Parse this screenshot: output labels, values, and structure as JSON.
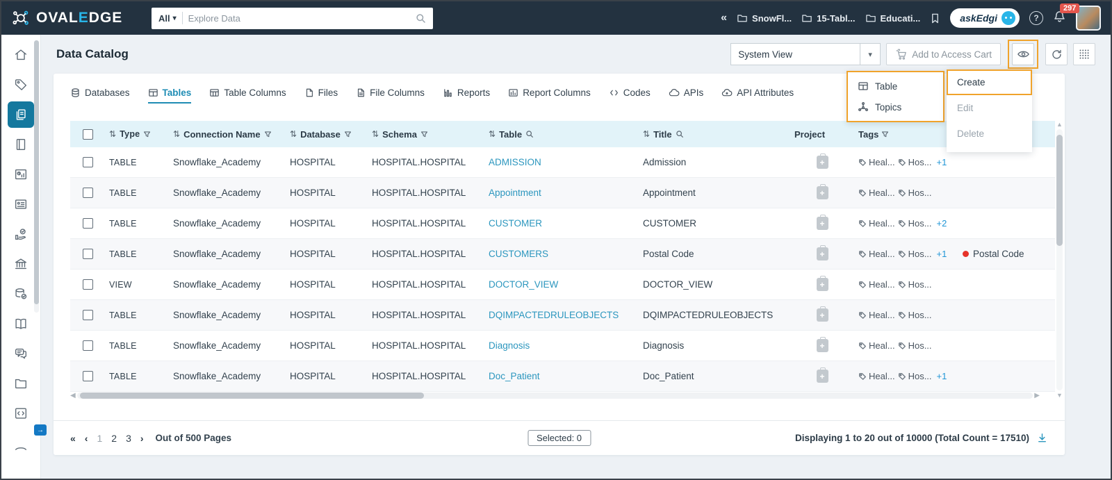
{
  "topbar": {
    "brand": "OVAL",
    "brand_accent": "E",
    "brand_rest": "DGE",
    "search_scope": "All",
    "search_placeholder": "Explore Data",
    "crumbs": [
      {
        "label": "SnowFl..."
      },
      {
        "label": "15-Tabl..."
      },
      {
        "label": "Educati..."
      }
    ],
    "ask_edgi_label": "askEdgi",
    "notification_count": "297"
  },
  "sidebar": {
    "items": [
      {
        "icon": "home-icon"
      },
      {
        "icon": "tag-icon"
      },
      {
        "icon": "data-catalog-icon",
        "active": true
      },
      {
        "icon": "notebook-icon"
      },
      {
        "icon": "report-clock-icon"
      },
      {
        "icon": "id-card-icon"
      },
      {
        "icon": "endorsement-icon"
      },
      {
        "icon": "bank-icon"
      },
      {
        "icon": "data-quality-icon"
      },
      {
        "icon": "glossary-icon"
      },
      {
        "icon": "chat-icon"
      },
      {
        "icon": "folder-icon"
      },
      {
        "icon": "code-icon"
      },
      {
        "icon": "graduation-icon"
      }
    ]
  },
  "header": {
    "title": "Data Catalog",
    "view_select_value": "System View",
    "add_to_cart_label": "Add to Access Cart"
  },
  "tabs": [
    {
      "label": "Databases"
    },
    {
      "label": "Tables",
      "active": true
    },
    {
      "label": "Table Columns"
    },
    {
      "label": "Files"
    },
    {
      "label": "File Columns"
    },
    {
      "label": "Reports"
    },
    {
      "label": "Report Columns"
    },
    {
      "label": "Codes"
    },
    {
      "label": "APIs"
    },
    {
      "label": "API Attributes"
    }
  ],
  "menus": {
    "object_menu": [
      {
        "label": "Table",
        "icon": "table-icon"
      },
      {
        "label": "Topics",
        "icon": "topics-icon"
      }
    ],
    "action_menu": [
      {
        "label": "Create",
        "highlighted": true
      },
      {
        "label": "Edit"
      },
      {
        "label": "Delete"
      }
    ]
  },
  "table": {
    "columns": {
      "type": "Type",
      "connection": "Connection Name",
      "database": "Database",
      "schema": "Schema",
      "table": "Table",
      "title": "Title",
      "project": "Project",
      "tags": "Tags"
    },
    "rows": [
      {
        "type": "TABLE",
        "connection": "Snowflake_Academy",
        "database": "HOSPITAL",
        "schema": "HOSPITAL.HOSPITAL",
        "table": "ADMISSION",
        "title": "Admission",
        "tags": [
          "Heal...",
          "Hos..."
        ],
        "more": "+1",
        "term": ""
      },
      {
        "type": "TABLE",
        "connection": "Snowflake_Academy",
        "database": "HOSPITAL",
        "schema": "HOSPITAL.HOSPITAL",
        "table": "Appointment",
        "title": "Appointment",
        "tags": [
          "Heal...",
          "Hos..."
        ],
        "more": "",
        "term": ""
      },
      {
        "type": "TABLE",
        "connection": "Snowflake_Academy",
        "database": "HOSPITAL",
        "schema": "HOSPITAL.HOSPITAL",
        "table": "CUSTOMER",
        "title": "CUSTOMER",
        "tags": [
          "Heal...",
          "Hos..."
        ],
        "more": "+2",
        "term": ""
      },
      {
        "type": "TABLE",
        "connection": "Snowflake_Academy",
        "database": "HOSPITAL",
        "schema": "HOSPITAL.HOSPITAL",
        "table": "CUSTOMERS",
        "title": "Postal Code",
        "tags": [
          "Heal...",
          "Hos..."
        ],
        "more": "+1",
        "term": "Postal Code"
      },
      {
        "type": "VIEW",
        "connection": "Snowflake_Academy",
        "database": "HOSPITAL",
        "schema": "HOSPITAL.HOSPITAL",
        "table": "DOCTOR_VIEW",
        "title": "DOCTOR_VIEW",
        "tags": [
          "Heal...",
          "Hos..."
        ],
        "more": "",
        "term": ""
      },
      {
        "type": "TABLE",
        "connection": "Snowflake_Academy",
        "database": "HOSPITAL",
        "schema": "HOSPITAL.HOSPITAL",
        "table": "DQIMPACTEDRULEOBJECTS",
        "title": "DQIMPACTEDRULEOBJECTS",
        "tags": [
          "Heal...",
          "Hos..."
        ],
        "more": "",
        "term": ""
      },
      {
        "type": "TABLE",
        "connection": "Snowflake_Academy",
        "database": "HOSPITAL",
        "schema": "HOSPITAL.HOSPITAL",
        "table": "Diagnosis",
        "title": "Diagnosis",
        "tags": [
          "Heal...",
          "Hos..."
        ],
        "more": "",
        "term": ""
      },
      {
        "type": "TABLE",
        "connection": "Snowflake_Academy",
        "database": "HOSPITAL",
        "schema": "HOSPITAL.HOSPITAL",
        "table": "Doc_Patient",
        "title": "Doc_Patient",
        "tags": [
          "Heal...",
          "Hos..."
        ],
        "more": "+1",
        "term": ""
      }
    ]
  },
  "pagination": {
    "first": "«",
    "prev": "‹",
    "pages": [
      "1",
      "2",
      "3"
    ],
    "current_page": "1",
    "next": "›",
    "out_of_label": "Out of 500 Pages",
    "selected_label": "Selected: 0",
    "summary": "Displaying 1 to 20  out of 10000  (Total Count = 17510)"
  },
  "colors": {
    "topbar_bg": "#233240",
    "accent_cyan": "#29b5e8",
    "active_teal": "#1e8cb4",
    "sidebar_active": "#14789e",
    "link_blue": "#2b96be",
    "highlight_orange": "#f0a32b",
    "badge_red": "#e4564d",
    "term_dot_red": "#e6332a",
    "header_row_bg": "#e2f3f9"
  }
}
